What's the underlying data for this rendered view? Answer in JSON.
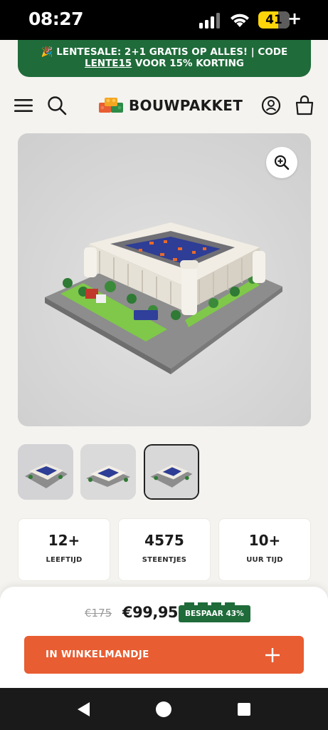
{
  "status_bar": {
    "time": "08:27",
    "battery": "41",
    "charging_icon": "plus-icon"
  },
  "promo": {
    "line1": "🎉 LENTESALE: 2+1 GRATIS OP ALLES! | CODE",
    "code": "LENTE15",
    "line2_rest": " VOOR 15% KORTING"
  },
  "header": {
    "logo_text": "BOUWPAKKET",
    "icons": [
      "menu-icon",
      "search-icon",
      "account-icon",
      "cart-bag-icon"
    ]
  },
  "gallery": {
    "zoom_icon": "zoom-in-icon",
    "thumbnails": 3,
    "active_thumbnail": 3
  },
  "stats": [
    {
      "value": "12+",
      "label": "LEEFTIJD"
    },
    {
      "value": "4575",
      "label": "STEENTJES"
    },
    {
      "value": "10+",
      "label": "UUR TIJD"
    }
  ],
  "purchase": {
    "old_price": "€175",
    "price": "€99,95",
    "save_badge": "BESPAAR 43%",
    "add_to_cart": "IN WINKELMANDJE"
  },
  "colors": {
    "brand_green": "#1f6b3a",
    "cta_orange": "#e85d32",
    "background": "#f4f3ef"
  }
}
